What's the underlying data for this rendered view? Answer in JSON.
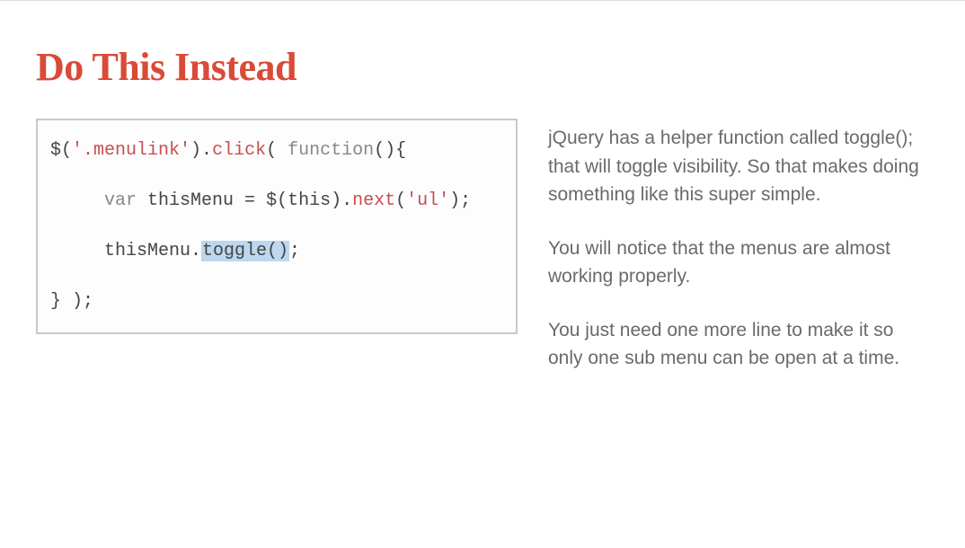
{
  "heading": "Do This Instead",
  "code": {
    "line1_a": "$(",
    "line1_b": "'.menulink'",
    "line1_c": ").",
    "line1_d": "click",
    "line1_e": "( ",
    "line1_f": "function",
    "line1_g": "(){",
    "line2_a": "     var",
    "line2_b": " thisMenu ",
    "line2_c": "= ",
    "line2_d": "$(this)",
    "line2_e": ".",
    "line2_f": "next",
    "line2_g": "(",
    "line2_h": "'ul'",
    "line2_i": ");",
    "line3_a": "     thisMenu.",
    "line3_b": "toggle()",
    "line3_c": ";",
    "line4_a": "} );"
  },
  "paragraphs": [
    "jQuery has a helper function called toggle(); that will toggle visibility. So that makes doing something like this super simple.",
    "You will notice that the menus are almost working properly.",
    "You just need one more line to make it so only one sub menu can be open at a time."
  ]
}
